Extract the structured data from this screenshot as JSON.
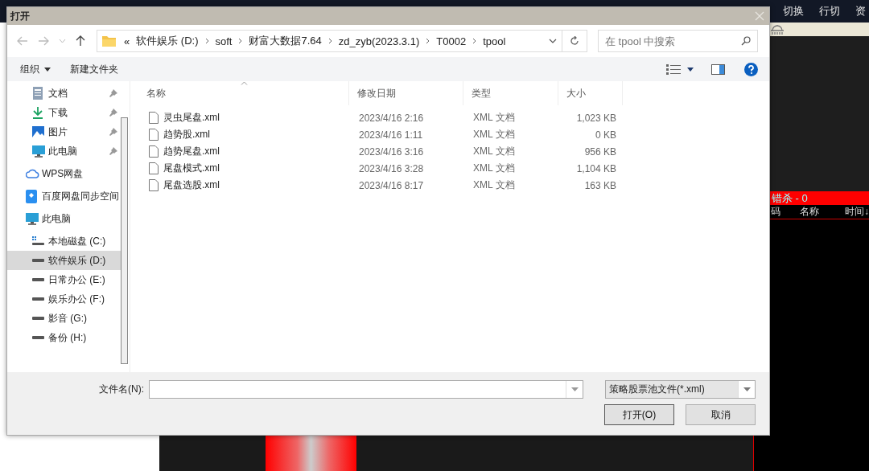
{
  "app": {
    "menu": [
      "切换",
      "行切",
      "资"
    ],
    "panel": {
      "title": "错杀 - 0",
      "columns": [
        "码",
        "名称",
        "时间↓"
      ]
    }
  },
  "window": {
    "title": "打开"
  },
  "address": {
    "path": [
      "软件娱乐 (D:)",
      "soft",
      "财富大数据7.64",
      "zd_zyb(2023.3.1)",
      "T0002",
      "tpool"
    ],
    "overflow": "«"
  },
  "search": {
    "placeholder": "在 tpool 中搜索"
  },
  "toolbar": {
    "organize": "组织",
    "new_folder": "新建文件夹"
  },
  "sidebar": {
    "quick_access": [
      {
        "label": "文档",
        "kind": "document",
        "pinned": true,
        "selected": false
      },
      {
        "label": "下载",
        "kind": "download",
        "pinned": true,
        "selected": false
      },
      {
        "label": "图片",
        "kind": "pictures",
        "pinned": true,
        "selected": false
      },
      {
        "label": "此电脑",
        "kind": "computer",
        "pinned": true,
        "selected": false
      }
    ],
    "items": [
      {
        "label": "WPS网盘",
        "kind": "cloud",
        "selected": false
      },
      {
        "label": "百度网盘同步空间",
        "kind": "sync",
        "selected": false
      },
      {
        "label": "此电脑",
        "kind": "computer",
        "selected": false,
        "children": [
          {
            "label": "本地磁盘 (C:)",
            "kind": "system",
            "selected": false
          },
          {
            "label": "软件娱乐 (D:)",
            "kind": "drive",
            "selected": true
          },
          {
            "label": "日常办公 (E:)",
            "kind": "drive",
            "selected": false
          },
          {
            "label": "娱乐办公 (F:)",
            "kind": "drive",
            "selected": false
          },
          {
            "label": "影音 (G:)",
            "kind": "drive",
            "selected": false
          },
          {
            "label": "备份 (H:)",
            "kind": "drive",
            "selected": false
          }
        ]
      }
    ]
  },
  "table": {
    "columns": [
      {
        "label": "名称",
        "sorted": true
      },
      {
        "label": "修改日期",
        "sorted": false
      },
      {
        "label": "类型",
        "sorted": false
      },
      {
        "label": "大小",
        "sorted": false
      }
    ],
    "rows": [
      {
        "name": "灵虫尾盘.xml",
        "date": "2023/4/16 2:16",
        "type": "XML 文档",
        "size": "1,023 KB"
      },
      {
        "name": "趋势股.xml",
        "date": "2023/4/16 1:11",
        "type": "XML 文档",
        "size": "0 KB"
      },
      {
        "name": "趋势尾盘.xml",
        "date": "2023/4/16 3:16",
        "type": "XML 文档",
        "size": "956 KB"
      },
      {
        "name": "尾盘模式.xml",
        "date": "2023/4/16 3:28",
        "type": "XML 文档",
        "size": "1,104 KB"
      },
      {
        "name": "尾盘选股.xml",
        "date": "2023/4/16 8:17",
        "type": "XML 文档",
        "size": "163 KB"
      }
    ]
  },
  "footer": {
    "filename_label": "文件名(N):",
    "filter": "策略股票池文件(*.xml)",
    "buttons": [
      {
        "label": "打开(O)",
        "kind": "primary"
      },
      {
        "label": "取消",
        "kind": "normal"
      }
    ]
  }
}
